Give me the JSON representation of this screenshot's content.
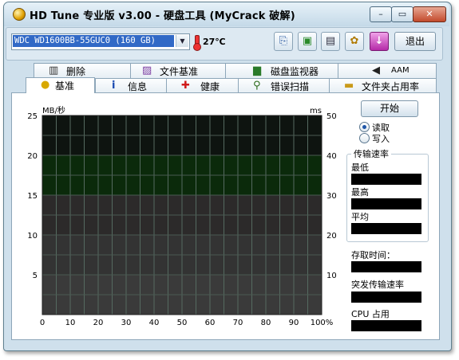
{
  "window": {
    "title": "HD Tune 专业版 v3.00 - 硬盘工具 (MyCrack 破解)",
    "min_glyph": "–",
    "max_glyph": "▭",
    "close_glyph": "✕"
  },
  "toolbar": {
    "drive": "WDC WD1600BB-55GUC0  (160 GB)",
    "temperature": "27℃",
    "exit_label": "退出",
    "icons": [
      "copy-info-icon",
      "copy-screenshot-icon",
      "save-icon",
      "options-icon",
      "download-icon"
    ]
  },
  "tabs_top": [
    {
      "label": "删除",
      "icon": "trash-icon"
    },
    {
      "label": "文件基准",
      "icon": "file-benchmark-icon"
    },
    {
      "label": "磁盘监视器",
      "icon": "disk-monitor-icon"
    },
    {
      "label": "AAM",
      "icon": "speaker-icon"
    }
  ],
  "tabs_bottom": [
    {
      "label": "基准",
      "icon": "lightbulb-icon",
      "active": true
    },
    {
      "label": "信息",
      "icon": "info-icon"
    },
    {
      "label": "健康",
      "icon": "health-cross-icon"
    },
    {
      "label": "错误扫描",
      "icon": "magnifier-icon"
    },
    {
      "label": "文件夹占用率",
      "icon": "folder-icon"
    }
  ],
  "side": {
    "start_label": "开始",
    "read_label": "读取",
    "write_label": "写入",
    "selected_mode": "read",
    "transfer_title": "传输速率",
    "min_label": "最低",
    "max_label": "最高",
    "avg_label": "平均",
    "access_label": "存取时间：",
    "burst_label": "突发传输速率",
    "cpu_label": "CPU 占用"
  },
  "chart_data": {
    "type": "line",
    "left_unit": "MB/秒",
    "right_unit": "ms",
    "y_left_range": [
      0,
      25
    ],
    "y_right_range": [
      0,
      50
    ],
    "x_range": [
      0,
      100
    ],
    "y_left_ticks": [
      "25",
      "20",
      "15",
      "10",
      "5"
    ],
    "y_right_ticks": [
      "50",
      "40",
      "30",
      "20",
      "10"
    ],
    "x_ticks": [
      "0",
      "10",
      "20",
      "30",
      "40",
      "50",
      "60",
      "70",
      "80",
      "90",
      "100%"
    ],
    "grid": true,
    "series": []
  }
}
